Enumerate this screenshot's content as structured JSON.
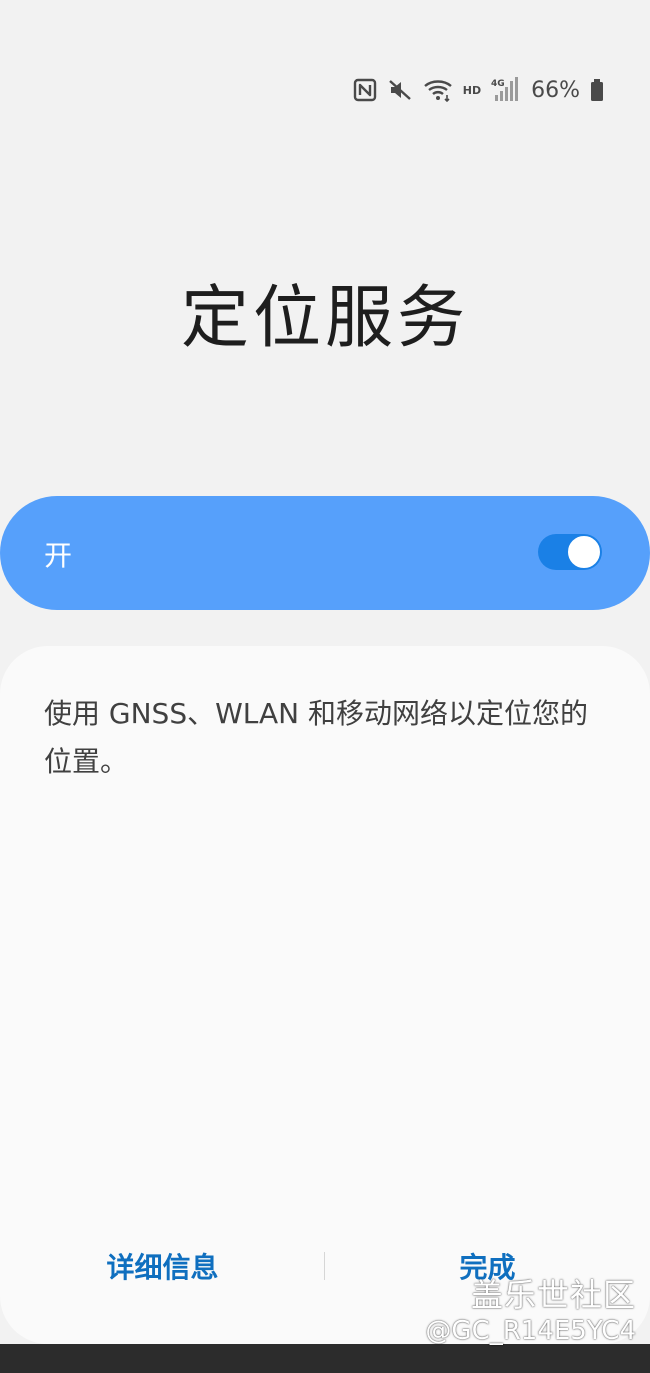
{
  "status_bar": {
    "icons": [
      "nfc-icon",
      "mute-icon",
      "wifi-icon",
      "hd-icon",
      "4g-signal-icon",
      "battery-icon"
    ],
    "hd_label": "HD",
    "battery_percent": "66%"
  },
  "page": {
    "title": "定位服务"
  },
  "master_switch": {
    "label": "开",
    "state": "on",
    "accent_color": "#56a0fb"
  },
  "card": {
    "description": "使用 GNSS、WLAN 和移动网络以定位您的位置。"
  },
  "footer": {
    "details_label": "详细信息",
    "done_label": "完成",
    "button_color": "#0f6fbf"
  },
  "watermark": {
    "line1": "盖乐世社区",
    "line2": "@GC_R14E5YC4"
  }
}
